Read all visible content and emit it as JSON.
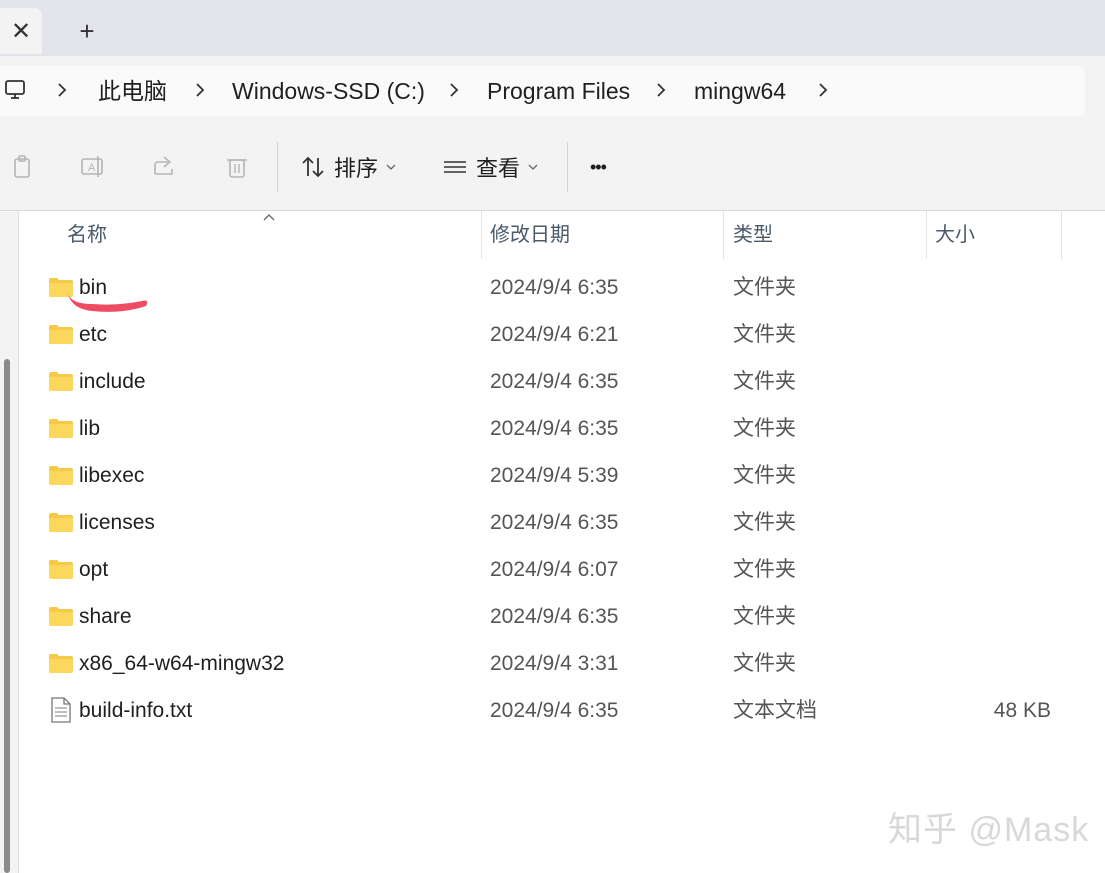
{
  "tabs": {
    "close_label": "✕",
    "new_tab_label": "+"
  },
  "breadcrumb": [
    "此电脑",
    "Windows-SSD (C:)",
    "Program Files",
    "mingw64"
  ],
  "toolbar": {
    "sort_label": "排序",
    "view_label": "查看",
    "more_label": "•••"
  },
  "columns": {
    "name": "名称",
    "date": "修改日期",
    "type": "类型",
    "size": "大小"
  },
  "files": [
    {
      "name": "bin",
      "date": "2024/9/4 6:35",
      "type": "文件夹",
      "size": ""
    },
    {
      "name": "etc",
      "date": "2024/9/4 6:21",
      "type": "文件夹",
      "size": ""
    },
    {
      "name": "include",
      "date": "2024/9/4 6:35",
      "type": "文件夹",
      "size": ""
    },
    {
      "name": "lib",
      "date": "2024/9/4 6:35",
      "type": "文件夹",
      "size": ""
    },
    {
      "name": "libexec",
      "date": "2024/9/4 5:39",
      "type": "文件夹",
      "size": ""
    },
    {
      "name": "licenses",
      "date": "2024/9/4 6:35",
      "type": "文件夹",
      "size": ""
    },
    {
      "name": "opt",
      "date": "2024/9/4 6:07",
      "type": "文件夹",
      "size": ""
    },
    {
      "name": "share",
      "date": "2024/9/4 6:35",
      "type": "文件夹",
      "size": ""
    },
    {
      "name": "x86_64-w64-mingw32",
      "date": "2024/9/4 3:31",
      "type": "文件夹",
      "size": ""
    },
    {
      "name": "build-info.txt",
      "date": "2024/9/4 6:35",
      "type": "文本文档",
      "size": "48 KB"
    }
  ],
  "watermark": "知乎 @Mask",
  "colors": {
    "folder": "#f7c948",
    "scribble": "#ee4c62",
    "header_text": "#4a5a6a"
  }
}
